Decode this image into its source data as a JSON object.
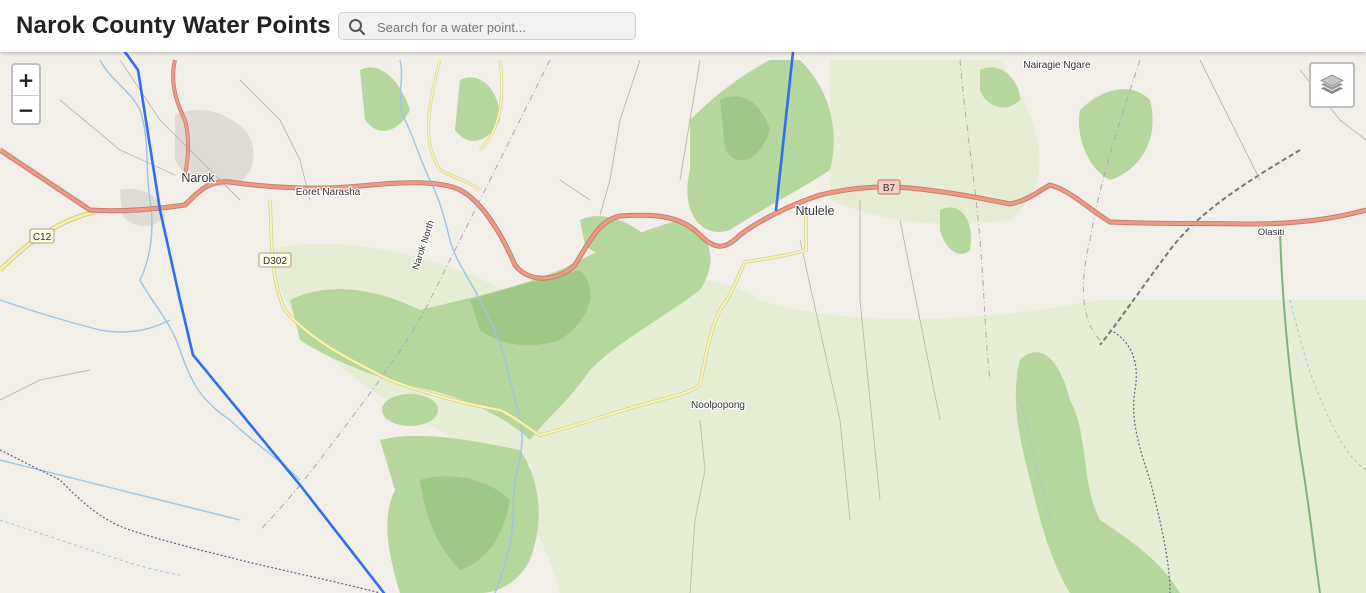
{
  "header": {
    "title": "Narok County Water Points",
    "search_placeholder": "Search for a water point..."
  },
  "controls": {
    "zoom_in": "+",
    "zoom_out": "−",
    "layers_icon": "layers-icon"
  },
  "map": {
    "places": {
      "narok": "Narok",
      "eoret_narasha": "Eoret Narasha",
      "narok_north": "Narok North",
      "ntulele": "Ntulele",
      "noolpopong": "Noolpopong",
      "nairagie_ngare": "Nairagie Ngare",
      "olasiti": "Olasiti"
    },
    "road_shields": {
      "c12": "C12",
      "d302": "D302",
      "b7": "B7"
    },
    "colors": {
      "background": "#f2efe9",
      "forest": "#a8cf8f",
      "trunk_road": "#e8977f",
      "secondary_road": "#f4f1a6",
      "water_line": "#2e6ef0",
      "river": "#9dc5e3"
    }
  }
}
